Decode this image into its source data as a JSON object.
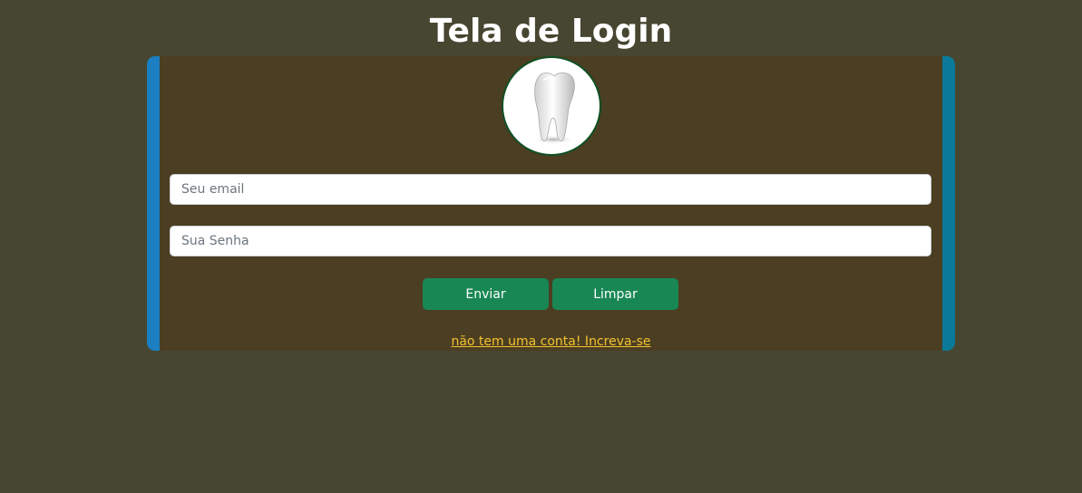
{
  "page": {
    "title": "Tela de Login"
  },
  "login_form": {
    "avatar_icon": "tooth-icon",
    "email_placeholder": "Seu email",
    "password_placeholder": "Sua Senha",
    "submit_label": "Enviar",
    "clear_label": "Limpar",
    "signup_link_text": "não tem uma conta! Increva-se"
  },
  "colors": {
    "page_background": "#474631",
    "card_background": "#4c3e22",
    "card_stripe_left": "#1b7fc1",
    "card_stripe_right": "#0a7a98",
    "button": "#198754",
    "link": "#f2c230"
  }
}
